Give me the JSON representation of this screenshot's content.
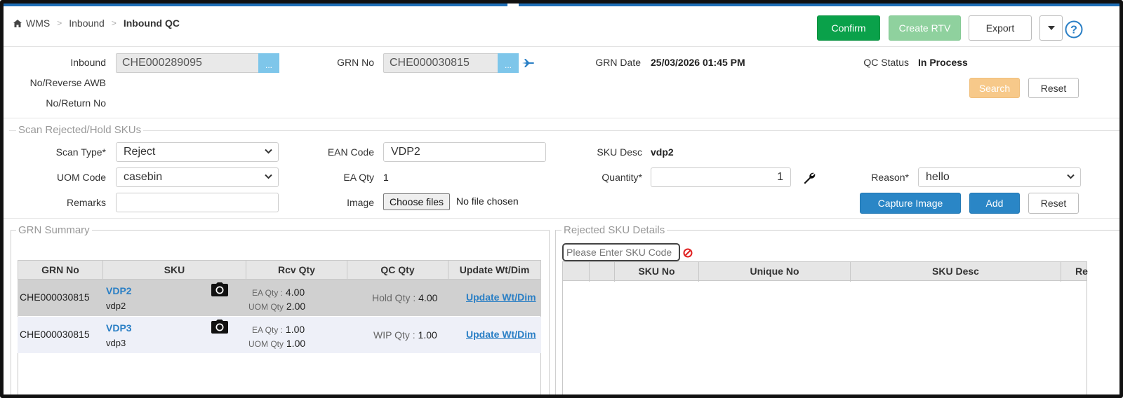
{
  "breadcrumb": {
    "home": "WMS",
    "section": "Inbound",
    "current": "Inbound QC"
  },
  "toolbar": {
    "confirm": "Confirm",
    "create_rtv": "Create RTV",
    "export": "Export"
  },
  "top_form": {
    "inbound_label_1": "Inbound",
    "inbound_label_2": "No/Reverse AWB",
    "inbound_label_3": "No/Return No",
    "inbound_value": "CHE000289095",
    "grn_no_label": "GRN No",
    "grn_no_value": "CHE000030815",
    "lookup_label": "...",
    "grn_date_label": "GRN Date",
    "grn_date_value": "25/03/2026 01:45 PM",
    "qc_status_label": "QC Status",
    "qc_status_value": "In Process",
    "search": "Search",
    "reset": "Reset"
  },
  "scan_section": {
    "legend": "Scan Rejected/Hold SKUs",
    "scan_type_label": "Scan Type*",
    "scan_type_value": "Reject",
    "ean_code_label": "EAN Code",
    "ean_code_value": "VDP2",
    "sku_desc_label": "SKU Desc",
    "sku_desc_value": "vdp2",
    "uom_code_label": "UOM Code",
    "uom_code_value": "casebin",
    "ea_qty_label": "EA Qty",
    "ea_qty_value": "1",
    "quantity_label": "Quantity*",
    "quantity_value": "1",
    "reason_label": "Reason*",
    "reason_value": "hello",
    "remarks_label": "Remarks",
    "remarks_value": "",
    "image_label": "Image",
    "choose_files": "Choose files",
    "no_file": "No file chosen",
    "capture_image": "Capture Image",
    "add": "Add",
    "reset": "Reset"
  },
  "grn_summary": {
    "legend": "GRN Summary",
    "columns": [
      "GRN No",
      "SKU",
      "Rcv Qty",
      "QC Qty",
      "Update Wt/Dim"
    ],
    "ea_qty_label": "EA Qty :",
    "uom_qty_label": "UOM Qty",
    "rows": [
      {
        "grn_no": "CHE000030815",
        "sku": "VDP2",
        "sku_desc": "vdp2",
        "ea_qty": "4.00",
        "uom_qty": "2.00",
        "qc_label": "Hold Qty :",
        "qc_value": "4.00",
        "update": "Update Wt/Dim"
      },
      {
        "grn_no": "CHE000030815",
        "sku": "VDP3",
        "sku_desc": "vdp3",
        "ea_qty": "1.00",
        "uom_qty": "1.00",
        "qc_label": "WIP Qty :",
        "qc_value": "1.00",
        "update": "Update Wt/Dim"
      }
    ]
  },
  "rejected_details": {
    "legend": "Rejected SKU Details",
    "search_placeholder": "Please Enter SKU Code",
    "columns": [
      "",
      "",
      "SKU No",
      "Unique No",
      "SKU Desc",
      "Re"
    ]
  },
  "colors": {
    "primary_blue": "#2a86c6",
    "green": "#0aa14a",
    "link": "#2a7fc5"
  }
}
